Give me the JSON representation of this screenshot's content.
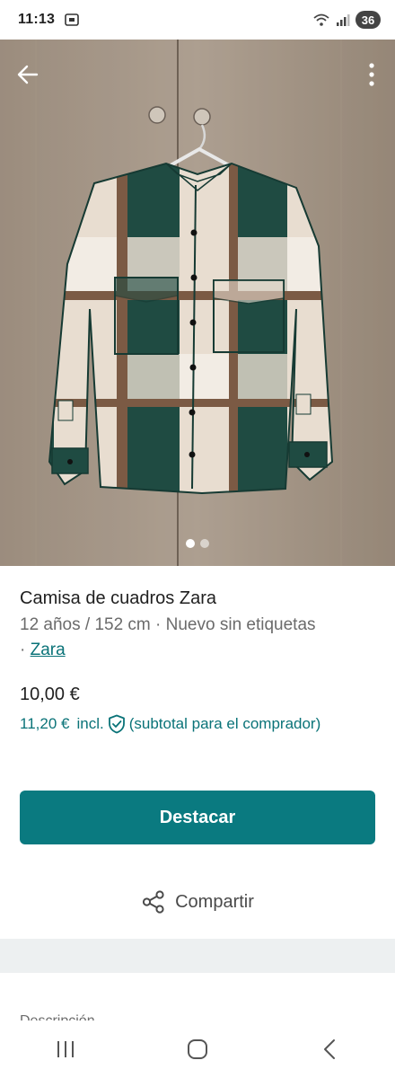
{
  "status_bar": {
    "time": "11:13",
    "battery": "36"
  },
  "product": {
    "title": "Camisa de cuadros Zara",
    "details": "12 años / 152 cm · Nuevo sin etiquetas",
    "separator": "· ",
    "brand": "Zara",
    "price": "10,00 €",
    "buyer_price": "11,20 €",
    "buyer_incl": "incl.",
    "buyer_note": "(subtotal para el comprador)"
  },
  "carousel": {
    "total": 2,
    "active_index": 0
  },
  "actions": {
    "destacar_label": "Destacar",
    "share_label": "Compartir"
  },
  "description": {
    "heading": "Descripción"
  },
  "icons": [
    "back-arrow-icon",
    "more-vert-icon",
    "shield-check-icon",
    "share-icon",
    "recents-icon",
    "home-icon",
    "nav-back-icon"
  ],
  "colors": {
    "accent": "#0a7a80",
    "link": "#0a7378",
    "band": "#edf0f1"
  }
}
